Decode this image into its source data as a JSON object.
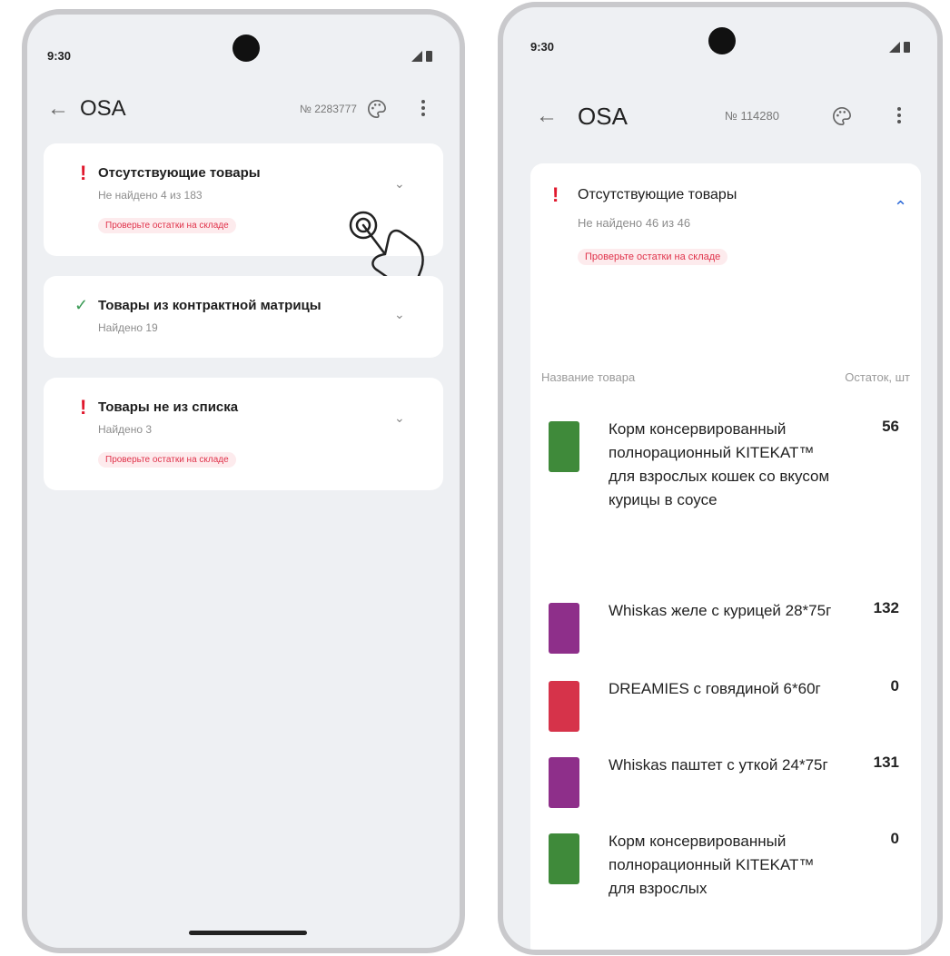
{
  "left": {
    "status": {
      "time": "9:30"
    },
    "appbar": {
      "title": "OSA",
      "doc_number": "№ 2283777"
    },
    "cards": [
      {
        "title": "Отсутствующие товары",
        "subtitle": "Не найдено 4 из 183",
        "badge": "Проверьте остатки на складе"
      },
      {
        "title": "Товары из контрактной матрицы",
        "subtitle": "Найдено 19"
      },
      {
        "title": "Товары не из списка",
        "subtitle": "Найдено 3",
        "badge": "Проверьте остатки на складе"
      }
    ]
  },
  "right": {
    "status": {
      "time": "9:30"
    },
    "appbar": {
      "title": "OSA",
      "doc_number": "№ 114280"
    },
    "card": {
      "title": "Отсутствующие товары",
      "subtitle": "Не найдено 46 из 46",
      "badge": "Проверьте остатки на складе"
    },
    "table": {
      "headers": [
        "Название товара",
        "Остаток, шт"
      ],
      "rows": [
        {
          "name": "Корм консервированный полнорационный KITEKAT™ для взрослых кошек со вкусом курицы в соусе",
          "qty": "56",
          "thumb": "#3f8a3a"
        },
        {
          "name": "Whiskas желе с курицей 28*75г",
          "qty": "132",
          "thumb": "#8e2f8a"
        },
        {
          "name": "DREAMIES с говядиной 6*60г",
          "qty": "0",
          "thumb": "#d6334a"
        },
        {
          "name": "Whiskas паштет с уткой 24*75г",
          "qty": "131",
          "thumb": "#8e2f8a"
        },
        {
          "name": "Корм консервированный полнорационный KITEKAT™ для взрослых",
          "qty": "0",
          "thumb": "#3f8a3a"
        }
      ]
    }
  },
  "colors": {
    "accent_red": "#e0182d",
    "ok_green": "#3a9a55",
    "badge_bg": "#fdebed",
    "screen_bg": "#eef0f3"
  }
}
